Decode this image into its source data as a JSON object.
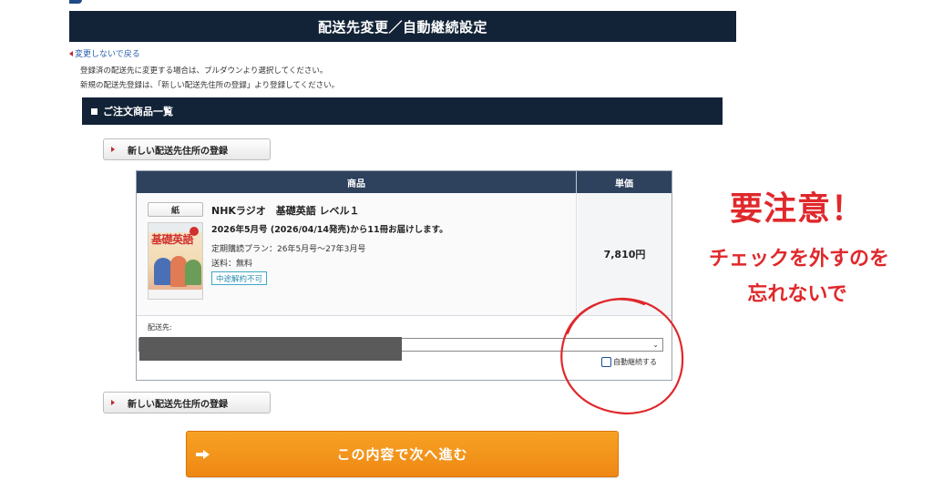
{
  "header": {
    "title": "配送先変更／自動継続設定"
  },
  "nav": {
    "back_label": "変更しないで戻る"
  },
  "instructions": {
    "line1": "登録済の配送先に変更する場合は、プルダウンより選択してください。",
    "line2": "新規の配送先登録は、「新しい配送先住所の登録」より登録してください。"
  },
  "section": {
    "title": "ご注文商品一覧"
  },
  "buttons": {
    "register_address": "新しい配送先住所の登録",
    "next": "この内容で次へ進む"
  },
  "table": {
    "col_product": "商品",
    "col_price": "単価"
  },
  "product": {
    "format_badge": "紙",
    "cover_title": "基礎英語",
    "name": "NHKラジオ　基礎英語 レベル１",
    "delivery": "2026年5月号 (2026/04/14発売)から11冊お届けします。",
    "plan": "定期購読プラン：26年5月号～27年3月号",
    "shipping": "送料：無料",
    "tag": "中途解約不可",
    "price": "7,810円"
  },
  "destination": {
    "label": "配送先:",
    "auto_renew_label": "自動継続する",
    "auto_renew_checked": false
  },
  "annotation": {
    "warning": "要注意！",
    "line1": "チェックを外すのを",
    "line2": "忘れないで",
    "color": "#e0282b"
  },
  "colors": {
    "navy": "#132337",
    "table_head": "#2e425e",
    "accent_orange": "#f39a1d",
    "link_blue": "#2a5fb0"
  }
}
